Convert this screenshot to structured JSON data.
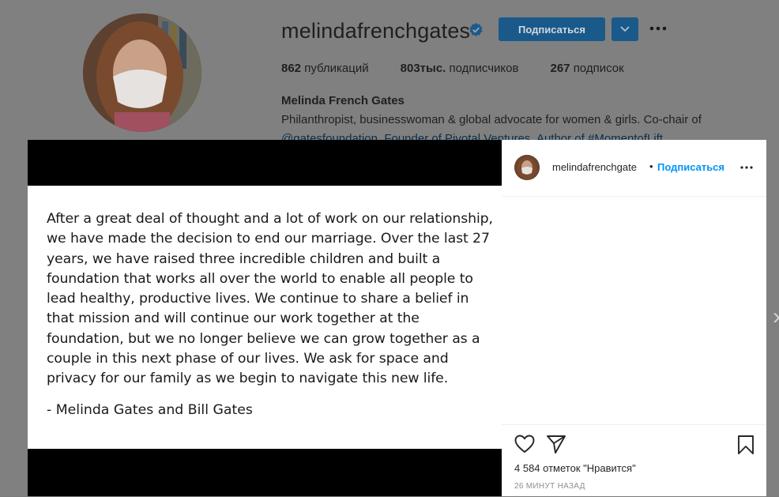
{
  "profile": {
    "username": "melindafrenchgates",
    "follow_label": "Подписаться",
    "stats": [
      {
        "value": "862",
        "label": "публикаций"
      },
      {
        "value": "803тыс.",
        "label": "подписчиков"
      },
      {
        "value": "267",
        "label": "подписок"
      }
    ],
    "full_name": "Melinda French Gates",
    "bio_line1": "Philanthropist, businesswoman & global advocate for women & girls. Co-chair of",
    "bio_line2": "@gatesfoundation. Founder of Pivotal Ventures. Author of #MomentofLift"
  },
  "post": {
    "text": "After a great deal of thought and a lot of work on our relationship, we have made the decision to end our marriage. Over the last 27 years, we have raised three incredible children and built a foundation that works all over the world to enable all people to lead healthy, productive lives. We continue to share a belief in that mission and will continue our work together at the foundation, but we no longer believe we can grow together as a couple in this next phase of our lives. We ask for space and privacy for our family as we begin to navigate this new life.",
    "signature": "- Melinda Gates and Bill Gates"
  },
  "side": {
    "username": "melindafrenchgate",
    "separator": "•",
    "follow_label": "Подписаться",
    "more_label": "•••",
    "likes": "4 584 отметок \"Нравится\"",
    "time": "26 МИНУТ НАЗАД"
  }
}
